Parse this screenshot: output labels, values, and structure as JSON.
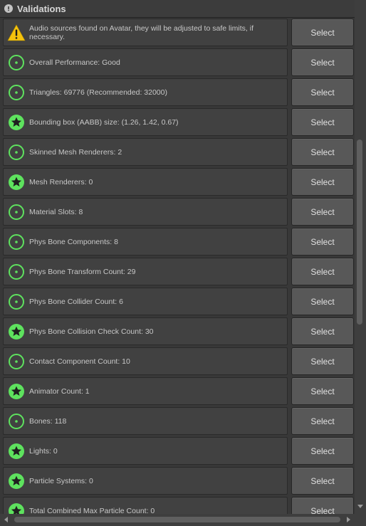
{
  "header": {
    "title": "Validations",
    "icon": "foldout-info-icon"
  },
  "colors": {
    "good": "#5ee25e",
    "warning": "#f4c20d",
    "button": "#585858",
    "row": "#414141"
  },
  "rows": [
    {
      "status": "warning",
      "icon": "warning-icon",
      "text": "Audio sources found on Avatar, they will be adjusted to safe limits, if necessary.",
      "button": "Select"
    },
    {
      "status": "good",
      "icon": "good-ring-icon",
      "text": "Overall Performance: Good",
      "button": "Select"
    },
    {
      "status": "good",
      "icon": "good-ring-icon",
      "text": "Triangles: 69776 (Recommended: 32000)",
      "button": "Select"
    },
    {
      "status": "excellent",
      "icon": "excellent-star-icon",
      "text": "Bounding box (AABB) size: (1.26, 1.42, 0.67)",
      "button": "Select"
    },
    {
      "status": "good",
      "icon": "good-ring-icon",
      "text": "Skinned Mesh Renderers: 2",
      "button": "Select"
    },
    {
      "status": "excellent",
      "icon": "excellent-star-icon",
      "text": "Mesh Renderers: 0",
      "button": "Select"
    },
    {
      "status": "good",
      "icon": "good-ring-icon",
      "text": "Material Slots: 8",
      "button": "Select"
    },
    {
      "status": "good",
      "icon": "good-ring-icon",
      "text": "Phys Bone Components: 8",
      "button": "Select"
    },
    {
      "status": "good",
      "icon": "good-ring-icon",
      "text": "Phys Bone Transform Count: 29",
      "button": "Select"
    },
    {
      "status": "good",
      "icon": "good-ring-icon",
      "text": "Phys Bone Collider Count: 6",
      "button": "Select"
    },
    {
      "status": "excellent",
      "icon": "excellent-star-icon",
      "text": "Phys Bone Collision Check Count: 30",
      "button": "Select"
    },
    {
      "status": "good",
      "icon": "good-ring-icon",
      "text": "Contact Component Count: 10",
      "button": "Select"
    },
    {
      "status": "excellent",
      "icon": "excellent-star-icon",
      "text": "Animator Count: 1",
      "button": "Select"
    },
    {
      "status": "good",
      "icon": "good-ring-icon",
      "text": "Bones: 118",
      "button": "Select"
    },
    {
      "status": "excellent",
      "icon": "excellent-star-icon",
      "text": "Lights: 0",
      "button": "Select"
    },
    {
      "status": "excellent",
      "icon": "excellent-star-icon",
      "text": "Particle Systems: 0",
      "button": "Select"
    },
    {
      "status": "excellent",
      "icon": "excellent-star-icon",
      "text": "Total Combined Max Particle Count: 0",
      "button": "Select"
    }
  ]
}
